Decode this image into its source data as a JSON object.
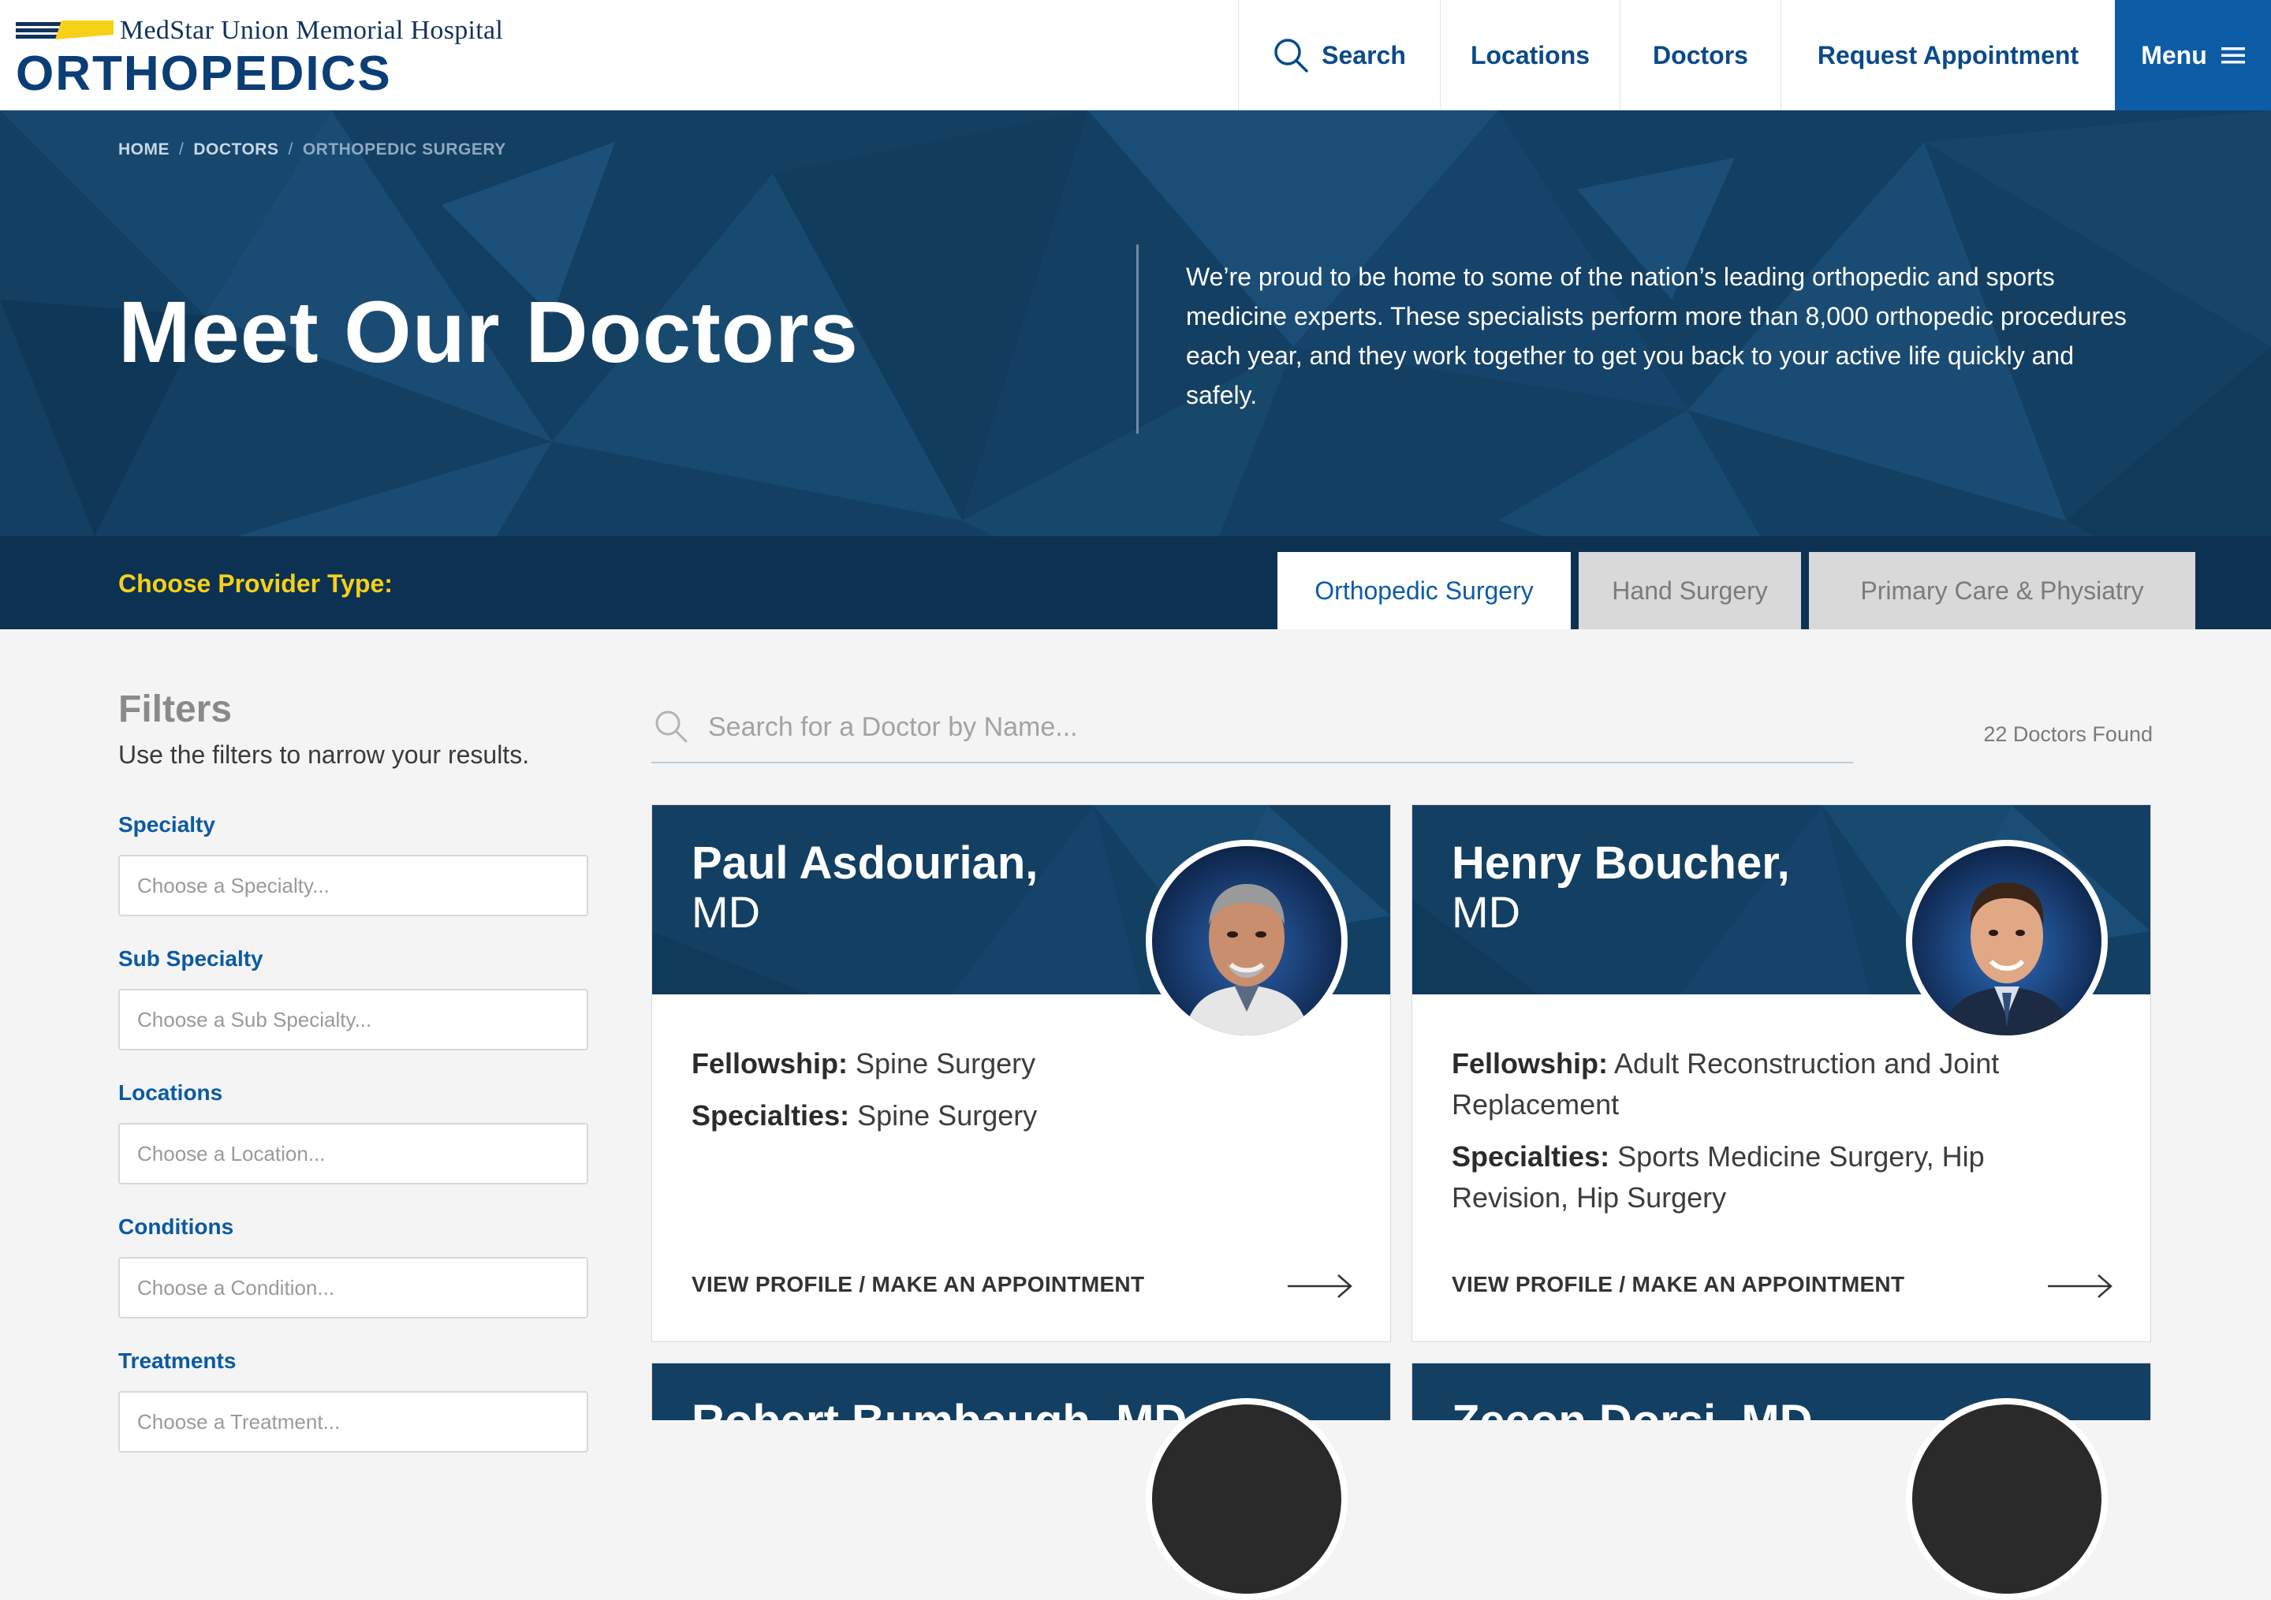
{
  "header": {
    "hospital_name": "MedStar Union Memorial Hospital",
    "department": "ORTHOPEDICS",
    "nav": {
      "search": "Search",
      "locations": "Locations",
      "doctors": "Doctors",
      "request_appointment": "Request Appointment",
      "menu": "Menu"
    }
  },
  "breadcrumb": [
    "HOME",
    "DOCTORS",
    "ORTHOPEDIC SURGERY"
  ],
  "hero": {
    "title": "Meet Our Doctors",
    "description": "We’re proud to be home to some of the nation’s leading orthopedic and sports medicine experts. These specialists perform more than 8,000 orthopedic procedures each year, and they work together to get you back to your active life quickly and safely."
  },
  "provider": {
    "label": "Choose Provider Type:",
    "tabs": [
      "Orthopedic Surgery",
      "Hand Surgery",
      "Primary Care & Physiatry"
    ],
    "active_tab": "Orthopedic Surgery"
  },
  "filters": {
    "title": "Filters",
    "subtitle": "Use the filters to narrow your results.",
    "groups": [
      {
        "label": "Specialty",
        "placeholder": "Choose a Specialty..."
      },
      {
        "label": "Sub Specialty",
        "placeholder": "Choose a Sub Specialty..."
      },
      {
        "label": "Locations",
        "placeholder": "Choose a Location..."
      },
      {
        "label": "Conditions",
        "placeholder": "Choose a Condition..."
      },
      {
        "label": "Treatments",
        "placeholder": "Choose a Treatment..."
      }
    ]
  },
  "search": {
    "placeholder": "Search for a Doctor by Name...",
    "results_count": "22 Doctors Found"
  },
  "doctors": [
    {
      "name": "Paul Asdourian,",
      "credential": "MD",
      "fellowship_label": "Fellowship:",
      "fellowship": "Spine Surgery",
      "specialties_label": "Specialties:",
      "specialties": "Spine Surgery",
      "cta": "VIEW PROFILE / MAKE AN APPOINTMENT"
    },
    {
      "name": "Henry Boucher,",
      "credential": "MD",
      "fellowship_label": "Fellowship:",
      "fellowship": "Adult Reconstruction and Joint Replacement",
      "specialties_label": "Specialties:",
      "specialties": "Sports Medicine Surgery, Hip Revision, Hip Surgery",
      "cta": "VIEW PROFILE / MAKE AN APPOINTMENT"
    },
    {
      "name": "Robert Bumbaugh,",
      "credential": "MD"
    },
    {
      "name": "Zeeon Dorsi,",
      "credential": "MD"
    }
  ],
  "colors": {
    "brand_navy": "#133f62",
    "brand_blue": "#0e5ba6",
    "accent_yellow": "#f7d117",
    "page_bg": "#f4f4f4"
  },
  "icons": [
    "search-icon",
    "menu-icon",
    "arrow-right-icon",
    "logo-flag-icon"
  ]
}
